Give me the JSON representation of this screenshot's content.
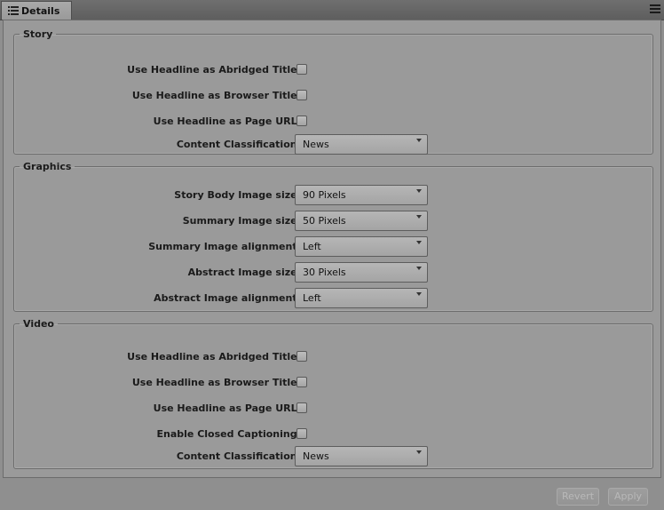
{
  "tab": {
    "label": "Details",
    "icon": "list-icon"
  },
  "story": {
    "legend": "Story",
    "abridged_label": "Use Headline as Abridged Title:",
    "browser_label": "Use Headline as Browser Title:",
    "pageurl_label": "Use Headline as Page URL:",
    "classification_label": "Content Classification:",
    "classification_value": "News"
  },
  "graphics": {
    "legend": "Graphics",
    "body_size_label": "Story Body Image size:",
    "body_size_value": "90 Pixels",
    "summary_size_label": "Summary Image size:",
    "summary_size_value": "50 Pixels",
    "summary_align_label": "Summary Image alignment:",
    "summary_align_value": "Left",
    "abstract_size_label": "Abstract Image size:",
    "abstract_size_value": "30 Pixels",
    "abstract_align_label": "Abstract Image alignment:",
    "abstract_align_value": "Left"
  },
  "video": {
    "legend": "Video",
    "abridged_label": "Use Headline as Abridged Title:",
    "browser_label": "Use Headline as Browser Title:",
    "pageurl_label": "Use Headline as Page URL:",
    "captioning_label": "Enable Closed Captioning:",
    "classification_label": "Content Classification:",
    "classification_value": "News"
  },
  "footer": {
    "revert": "Revert",
    "apply": "Apply"
  }
}
